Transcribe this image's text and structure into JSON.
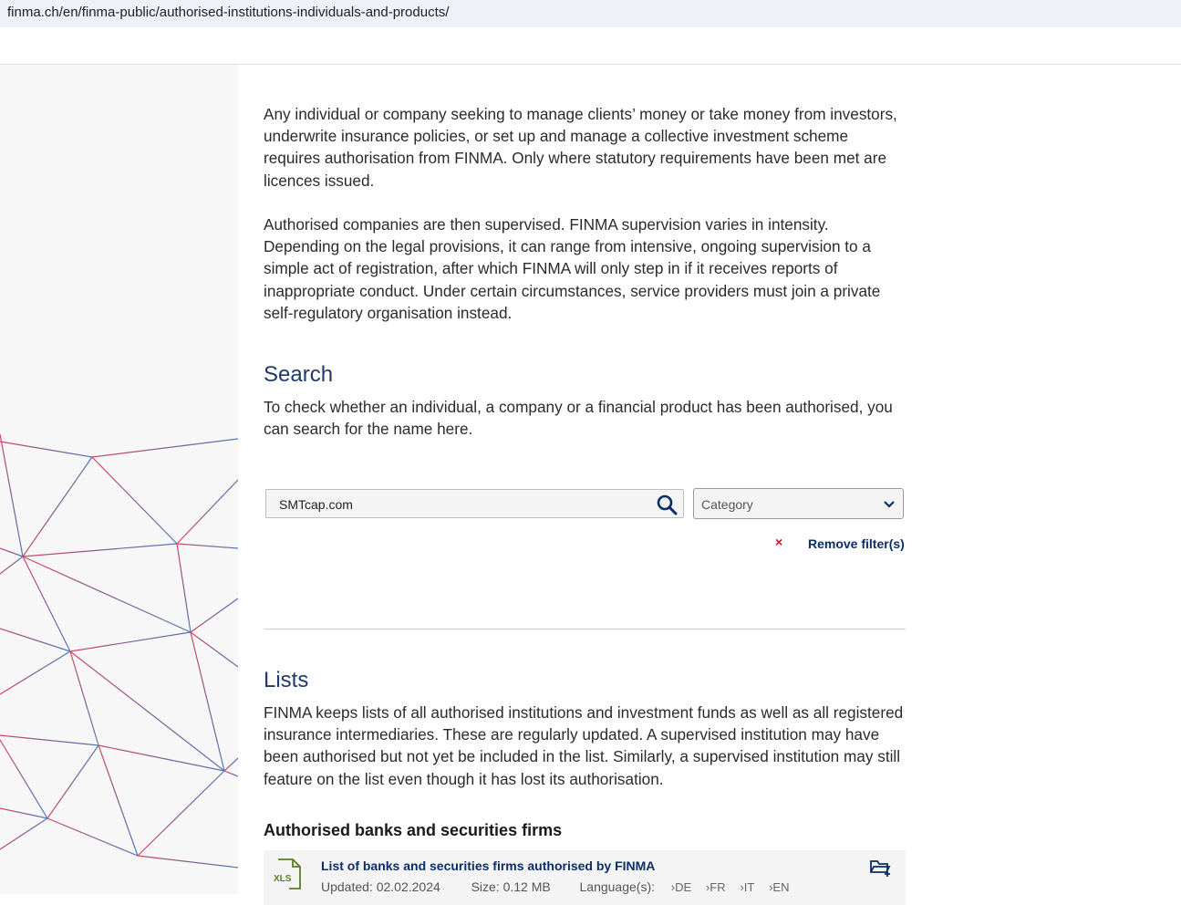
{
  "browser": {
    "url": "finma.ch/en/finma-public/authorised-institutions-individuals-and-products/"
  },
  "intro": {
    "p1": "Any individual or company seeking to manage clients’ money or take money from investors, underwrite insurance policies, or set up and manage a collective investment scheme requires authorisation from FINMA. Only where statutory requirements have been met are licences issued.",
    "p2": "Authorised companies are then supervised. FINMA supervision varies in intensity. Depending on the legal provisions, it can range from intensive, ongoing supervision to a simple act of registration, after which FINMA will only step in if it receives reports of inappropriate conduct. Under certain circumstances, service providers must join a private self-regulatory organisation instead."
  },
  "search": {
    "heading": "Search",
    "description": "To check whether an individual, a company or a financial product has been authorised, you can search for the name here.",
    "input_value": "SMTcap.com",
    "category_placeholder": "Category",
    "remove_x": "×",
    "remove_filters_label": "Remove filter(s)"
  },
  "lists": {
    "heading": "Lists",
    "description": "FINMA keeps lists of all authorised institutions and investment funds as well as all registered insurance intermediaries. These are regularly updated. A supervised institution may have been authorised but not yet be included in the list. Similarly, a supervised institution may still feature on the list even though it has lost its authorisation.",
    "section_title": "Authorised banks and securities firms",
    "file": {
      "icon_label": "XLS",
      "title": "List of banks and securities firms authorised by FINMA",
      "updated": "Updated: 02.02.2024",
      "size": "Size: 0.12  MB",
      "languages_label": "Language(s):",
      "languages": [
        "›DE",
        "›FR",
        "›IT",
        "›EN"
      ]
    }
  },
  "colors": {
    "heading_blue": "#1f3a6b",
    "link_navy": "#0c2d66",
    "remove_red": "#c8102e",
    "sidebar_bg": "#f7f7f8"
  }
}
